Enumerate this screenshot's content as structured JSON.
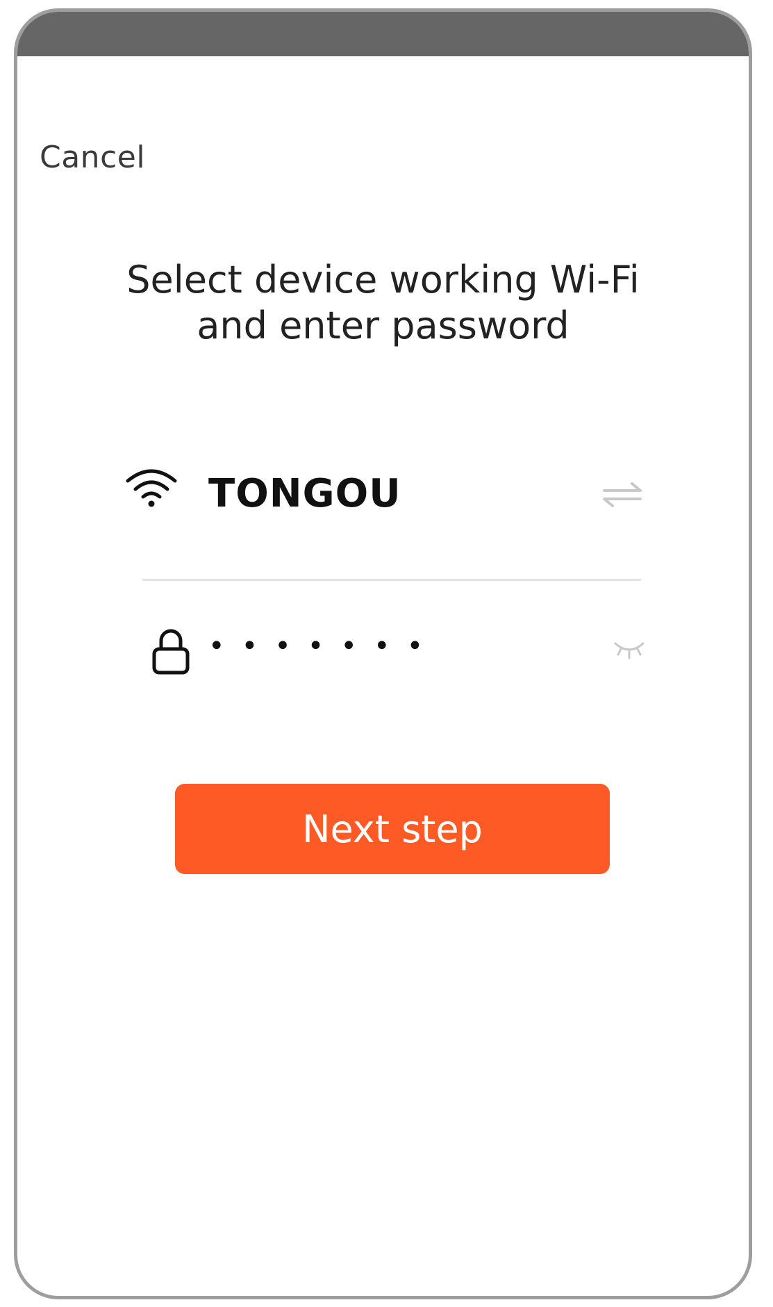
{
  "header": {
    "cancel_label": "Cancel"
  },
  "title": {
    "line1": "Select device working Wi-Fi",
    "line2": "and enter password"
  },
  "wifi": {
    "network_name": "TONGOU",
    "icon": "wifi-icon",
    "switch_icon": "switch-network-icon"
  },
  "password": {
    "value": "•••••••",
    "lock_icon": "lock-icon",
    "visibility_icon": "eye-closed-icon"
  },
  "actions": {
    "next_label": "Next step"
  },
  "colors": {
    "accent": "#fe5a26",
    "top_bar": "#666666",
    "frame": "#9e9e9e"
  }
}
